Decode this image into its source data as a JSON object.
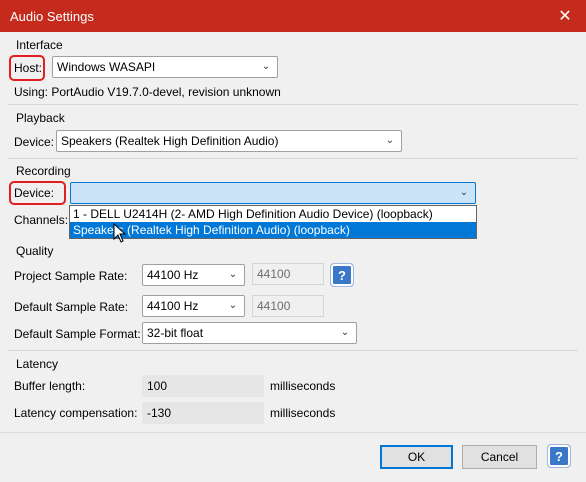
{
  "window": {
    "title": "Audio Settings",
    "close_glyph": "✕"
  },
  "interface": {
    "group": "Interface",
    "host_label": "Host:",
    "host_value": "Windows WASAPI",
    "using_text": "Using: PortAudio V19.7.0-devel, revision unknown"
  },
  "playback": {
    "group": "Playback",
    "device_label": "Device:",
    "device_value": "Speakers (Realtek High Definition Audio)"
  },
  "recording": {
    "group": "Recording",
    "device_label": "Device:",
    "device_value": "",
    "channels_label": "Channels:",
    "dropdown_options": [
      "1 - DELL U2414H (2- AMD High Definition Audio Device) (loopback)",
      "Speakers (Realtek High Definition Audio) (loopback)"
    ],
    "selected_option_index": 1
  },
  "quality": {
    "group": "Quality",
    "project_rate_label": "Project Sample Rate:",
    "project_rate_value": "44100 Hz",
    "project_rate_custom": "44100",
    "default_rate_label": "Default Sample Rate:",
    "default_rate_value": "44100 Hz",
    "default_rate_custom": "44100",
    "format_label": "Default Sample Format:",
    "format_value": "32-bit float"
  },
  "latency": {
    "group": "Latency",
    "buffer_label": "Buffer length:",
    "buffer_value": "100",
    "buffer_unit": "milliseconds",
    "compensation_label": "Latency compensation:",
    "compensation_value": "-130",
    "compensation_unit": "milliseconds"
  },
  "footer": {
    "ok_label": "OK",
    "cancel_label": "Cancel"
  },
  "help_glyph": "?",
  "colors": {
    "titlebar": "#c42b1c",
    "accent": "#0078d7",
    "highlight_box": "#e02020"
  }
}
